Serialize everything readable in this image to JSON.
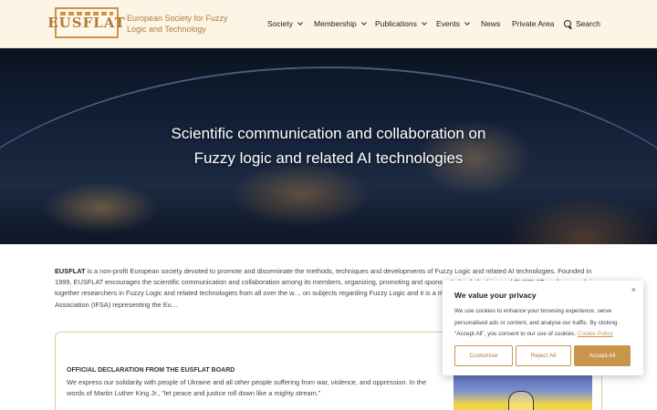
{
  "header": {
    "logo_text": "EUSFLAT",
    "brand_name": "European Society for Fuzzy Logic and Technology",
    "nav": {
      "society": "Society",
      "membership": "Membership",
      "publications": "Publications",
      "events": "Events",
      "news": "News",
      "private_area": "Private Area",
      "search": "Search"
    }
  },
  "hero": {
    "title_line1": "Scientific communication and collaboration on",
    "title_line2": "Fuzzy logic and related AI technologies"
  },
  "intro": {
    "lead": "EUSFLAT",
    "text": " is a non-profit European society devoted to promote and disseminate the methods, techniques and developments of Fuzzy Logic and related AI technologies. Founded in 1999, EUSFLAT encourages the scientific communication and collaboration among its members, organizing, promoting and spons… Indeed, the biannual EUSFLAT conferences bring together researchers in Fuzzy Logic and related technologies from all over the w… on subjects regarding Fuzzy Logic and it is a member of the International Fuzzy Systems Association (IFSA) representing the Eu…"
  },
  "declaration": {
    "title": "OFFICIAL DECLARATION FROM THE EUSFLAT BOARD",
    "text": "We express our solidarity with people of Ukraine and all other people suffering from war, violence, and oppression. In the words of Martin Luther King Jr., \"let peace and justice roll down like a mighty stream.\""
  },
  "cookie": {
    "title": "We value your privacy",
    "close": "×",
    "text": "We use cookies to enhance your browsing experience, serve personalised ads or content, and analyse our traffic. By clicking \"Accept All\", you consent to our use of cookies.",
    "policy_link": "Cookie Policy",
    "customise": "Customise",
    "reject_all": "Reject All",
    "accept_all": "Accept All"
  },
  "colors": {
    "accent": "#c9954a",
    "header_bg": "#fcf5e5"
  }
}
